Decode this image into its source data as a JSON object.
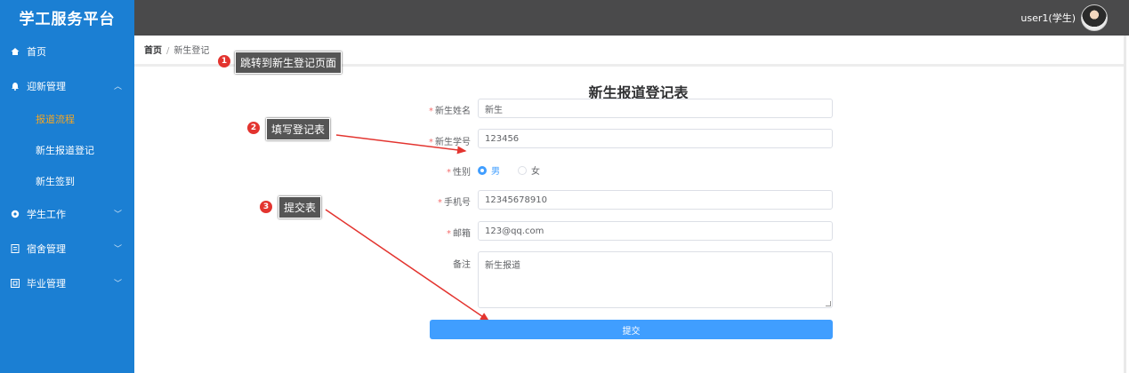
{
  "app": {
    "brand": "学工服务平台"
  },
  "header": {
    "user_name": "user1(学生)"
  },
  "sidebar": {
    "items": [
      {
        "label": "首页",
        "icon": "home-icon"
      },
      {
        "label": "迎新管理",
        "icon": "bell-icon",
        "expanded": true
      },
      {
        "label": "学生工作",
        "icon": "gear-icon"
      },
      {
        "label": "宿舍管理",
        "icon": "document-icon"
      },
      {
        "label": "毕业管理",
        "icon": "grid-icon"
      }
    ],
    "submenu": [
      {
        "label": "报道流程",
        "active": true
      },
      {
        "label": "新生报道登记"
      },
      {
        "label": "新生签到"
      }
    ]
  },
  "breadcrumb": {
    "home": "首页",
    "current": "新生登记"
  },
  "annotations": [
    {
      "num": "1",
      "text": "跳转到新生登记页面"
    },
    {
      "num": "2",
      "text": "填写登记表"
    },
    {
      "num": "3",
      "text": "提交表"
    }
  ],
  "form": {
    "title": "新生报道登记表",
    "name_label": "新生姓名",
    "name_value": "新生",
    "id_label": "新生学号",
    "id_value": "123456",
    "gender_label": "性别",
    "gender_male": "男",
    "gender_female": "女",
    "gender_selected": "男",
    "phone_label": "手机号",
    "phone_value": "12345678910",
    "email_label": "邮箱",
    "email_value": "123@qq.com",
    "remark_label": "备注",
    "remark_value": "新生报道",
    "submit_label": "提交"
  },
  "colors": {
    "sidebar": "#1b7fd3",
    "header": "#4a4a4b",
    "primary": "#409eff",
    "active_menu": "#f5a623",
    "annotation": "#e3342f"
  }
}
